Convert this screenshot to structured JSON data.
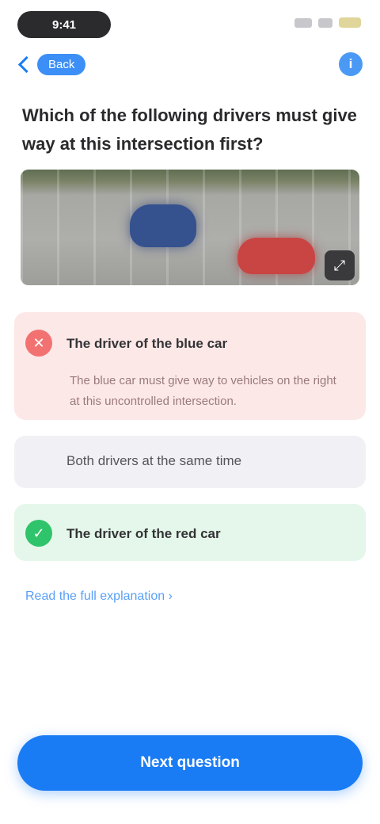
{
  "status_bar": {
    "time": "9:41"
  },
  "nav": {
    "back_label": "Back",
    "info_label": "i"
  },
  "question": {
    "text": "Which of the following drivers must give way at this intersection first?"
  },
  "scene": {
    "zoom_label": "⤢"
  },
  "answers": [
    {
      "state": "wrong",
      "icon_glyph": "✕",
      "text": "The driver of the blue car",
      "explanation": "The blue car must give way to vehicles on the right at this uncontrolled intersection."
    },
    {
      "state": "neutral",
      "text": "Both drivers at the same time"
    },
    {
      "state": "correct",
      "icon_glyph": "✓",
      "text": "The driver of the red car"
    }
  ],
  "explain_link": "Read the full explanation ›",
  "next_button": "Next question",
  "colors": {
    "accent": "#1a7cf5",
    "wrong": "#f27272",
    "correct": "#2fc46b"
  }
}
